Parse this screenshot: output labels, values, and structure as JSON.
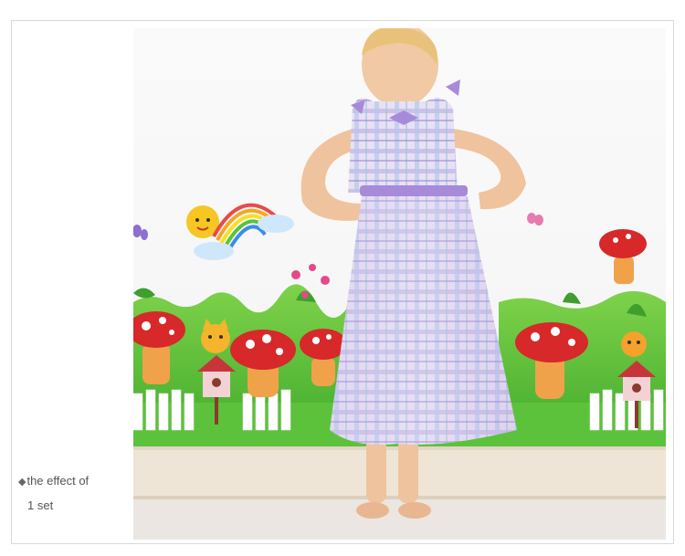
{
  "caption": {
    "bullet": "◆",
    "line1": "the effect of",
    "line2": "1 set"
  },
  "photo": {
    "icon": "wall-sticker-photo",
    "colors": {
      "wall": "#f7f7f7",
      "grass": "#5fc03a",
      "mushroom_red": "#d7282a",
      "mushroom_stem": "#f0a24a",
      "dress_lilac": "#b9a6da",
      "skirting": "#efe4d4",
      "floor": "#e9e3dc"
    }
  }
}
